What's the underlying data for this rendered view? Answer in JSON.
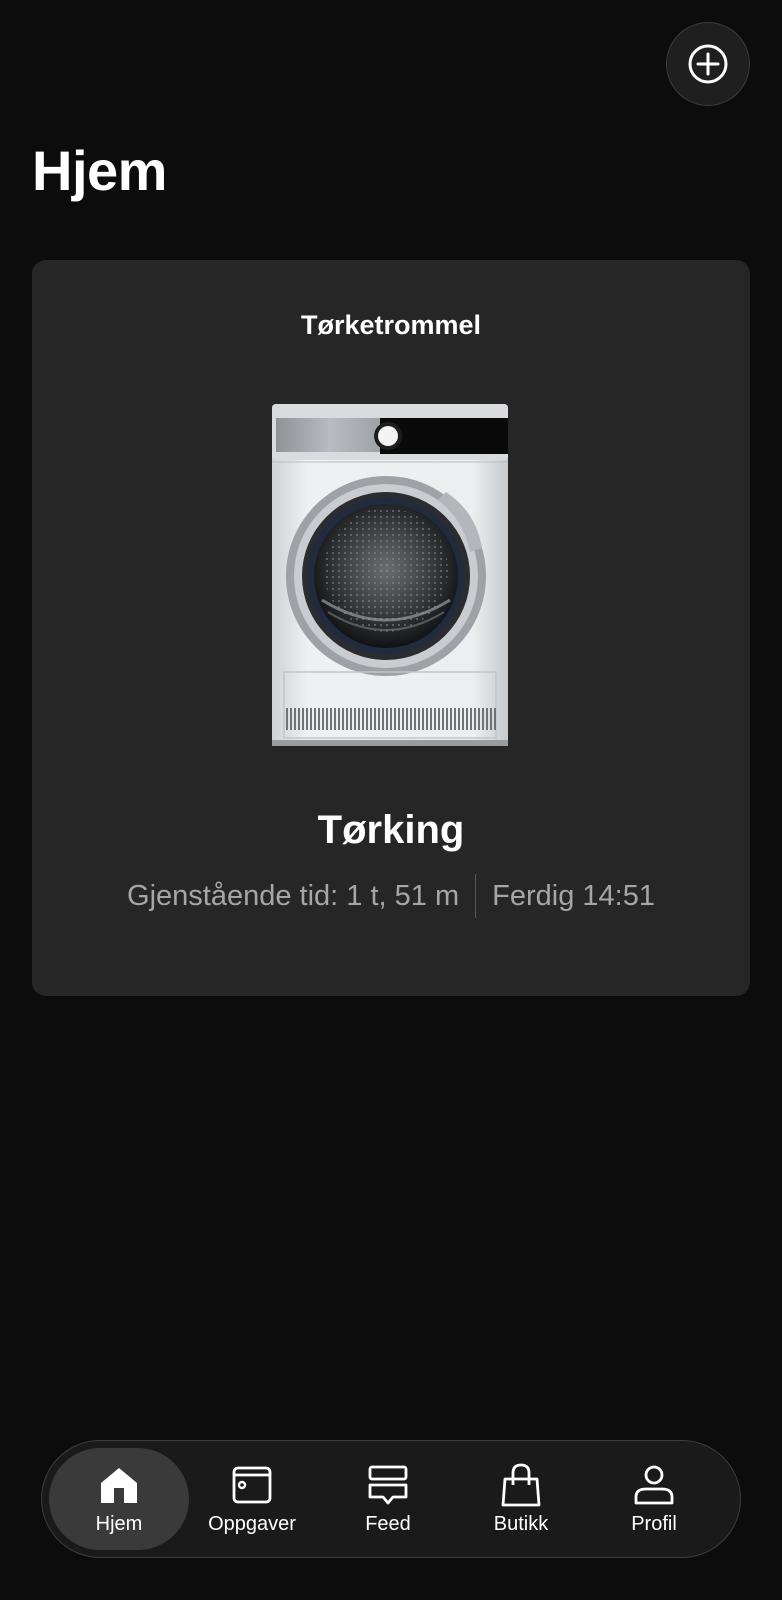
{
  "header": {
    "title": "Hjem",
    "add_icon": "plus-circle-icon"
  },
  "card": {
    "device_name": "Tørketrommel",
    "device_image": "tumble-dryer",
    "status": "Tørking",
    "remaining": "Gjenstående tid: 1 t, 51 m",
    "finish": "Ferdig 14:51"
  },
  "nav": {
    "items": [
      {
        "label": "Hjem",
        "icon": "home-icon",
        "active": true
      },
      {
        "label": "Oppgaver",
        "icon": "tasks-icon",
        "active": false
      },
      {
        "label": "Feed",
        "icon": "feed-icon",
        "active": false
      },
      {
        "label": "Butikk",
        "icon": "shopping-bag-icon",
        "active": false
      },
      {
        "label": "Profil",
        "icon": "profile-icon",
        "active": false
      }
    ]
  },
  "colors": {
    "background": "#0c0c0c",
    "card": "#262626",
    "text_primary": "#ffffff",
    "text_secondary": "#a6a6a6",
    "nav_active": "#3a3a3a"
  }
}
